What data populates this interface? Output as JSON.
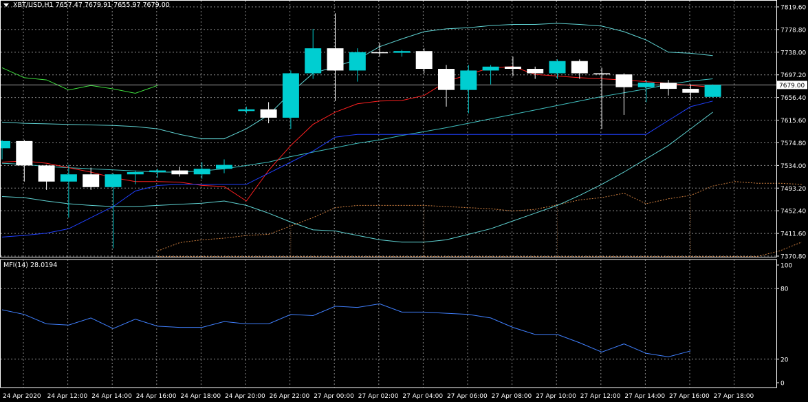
{
  "header": {
    "symbol_info": "XBT/USD,H1  7657.47 7679.91 7655.97 7679.00"
  },
  "mfi": {
    "label": "MFI(14) 28.0194"
  },
  "colors": {
    "background": "#000000",
    "grid": "#ffffff",
    "bull_candle": "#00ced1",
    "bear_candle": "#ffffff",
    "bb_outer": "#5fd3d3",
    "bb_mid": "#40c0c0",
    "red_line": "#ff2020",
    "blue_line": "#2040ff",
    "green_line": "#40e040",
    "ichimoku_cloud": "#d08040",
    "mfi_line": "#4080ff",
    "price_line": "#cccccc"
  },
  "chart_data": [
    {
      "type": "candlestick",
      "title": "XBT/USD,H1",
      "current_price": 7679.0,
      "current_price_label": "7679.00",
      "ylim": [
        7370.8,
        7819.6
      ],
      "y_ticks": [
        "7819.60",
        "7778.80",
        "7738.00",
        "7697.20",
        "7656.40",
        "7615.60",
        "7574.80",
        "7534.00",
        "7493.20",
        "7452.40",
        "7411.60",
        "7370.80"
      ],
      "y_tick_values": [
        7819.6,
        7778.8,
        7738.0,
        7697.2,
        7656.4,
        7615.6,
        7574.8,
        7534.0,
        7493.2,
        7452.4,
        7411.6,
        7370.8
      ],
      "x_labels": [
        "24 Apr 2020",
        "24 Apr 12:00",
        "24 Apr 14:00",
        "24 Apr 16:00",
        "24 Apr 18:00",
        "24 Apr 20:00",
        "26 Apr 22:00",
        "27 Apr 00:00",
        "27 Apr 02:00",
        "27 Apr 04:00",
        "27 Apr 06:00",
        "27 Apr 08:00",
        "27 Apr 10:00",
        "27 Apr 12:00",
        "27 Apr 14:00",
        "27 Apr 16:00",
        "27 Apr 18:00"
      ],
      "candles": [
        {
          "o": 7565,
          "h": 7580,
          "l": 7545,
          "c": 7578
        },
        {
          "o": 7578,
          "h": 7580,
          "l": 7505,
          "c": 7534
        },
        {
          "o": 7534,
          "h": 7535,
          "l": 7490,
          "c": 7505
        },
        {
          "o": 7505,
          "h": 7535,
          "l": 7440,
          "c": 7518
        },
        {
          "o": 7518,
          "h": 7530,
          "l": 7490,
          "c": 7495
        },
        {
          "o": 7495,
          "h": 7520,
          "l": 7385,
          "c": 7518
        },
        {
          "o": 7518,
          "h": 7525,
          "l": 7500,
          "c": 7522
        },
        {
          "o": 7522,
          "h": 7528,
          "l": 7512,
          "c": 7525
        },
        {
          "o": 7525,
          "h": 7532,
          "l": 7514,
          "c": 7518
        },
        {
          "o": 7518,
          "h": 7540,
          "l": 7510,
          "c": 7528
        },
        {
          "o": 7528,
          "h": 7545,
          "l": 7520,
          "c": 7535
        },
        {
          "o": 7632,
          "h": 7640,
          "l": 7628,
          "c": 7635
        },
        {
          "o": 7635,
          "h": 7648,
          "l": 7610,
          "c": 7620
        },
        {
          "o": 7620,
          "h": 7705,
          "l": 7600,
          "c": 7700
        },
        {
          "o": 7700,
          "h": 7780,
          "l": 7690,
          "c": 7745
        },
        {
          "o": 7745,
          "h": 7808,
          "l": 7650,
          "c": 7705
        },
        {
          "o": 7705,
          "h": 7745,
          "l": 7685,
          "c": 7738
        },
        {
          "o": 7738,
          "h": 7755,
          "l": 7730,
          "c": 7737
        },
        {
          "o": 7737,
          "h": 7742,
          "l": 7730,
          "c": 7740
        },
        {
          "o": 7740,
          "h": 7745,
          "l": 7700,
          "c": 7708
        },
        {
          "o": 7708,
          "h": 7715,
          "l": 7640,
          "c": 7670
        },
        {
          "o": 7670,
          "h": 7715,
          "l": 7628,
          "c": 7705
        },
        {
          "o": 7705,
          "h": 7715,
          "l": 7680,
          "c": 7712
        },
        {
          "o": 7712,
          "h": 7730,
          "l": 7695,
          "c": 7708
        },
        {
          "o": 7708,
          "h": 7712,
          "l": 7690,
          "c": 7700
        },
        {
          "o": 7700,
          "h": 7725,
          "l": 7690,
          "c": 7722
        },
        {
          "o": 7722,
          "h": 7725,
          "l": 7690,
          "c": 7700
        },
        {
          "o": 7700,
          "h": 7710,
          "l": 7600,
          "c": 7698
        },
        {
          "o": 7698,
          "h": 7700,
          "l": 7625,
          "c": 7675
        },
        {
          "o": 7675,
          "h": 7688,
          "l": 7648,
          "c": 7683
        },
        {
          "o": 7683,
          "h": 7688,
          "l": 7660,
          "c": 7672
        },
        {
          "o": 7672,
          "h": 7680,
          "l": 7652,
          "c": 7665
        },
        {
          "o": 7657.47,
          "h": 7679.91,
          "l": 7655.97,
          "c": 7679.0
        }
      ],
      "series": [
        {
          "name": "bb_upper",
          "values": [
            7612,
            7610,
            7609,
            7608,
            7607,
            7606,
            7604,
            7600,
            7590,
            7582,
            7582,
            7600,
            7625,
            7665,
            7700,
            7712,
            7725,
            7748,
            7762,
            7775,
            7780,
            7782,
            7786,
            7788,
            7788,
            7790,
            7788,
            7785,
            7775,
            7760,
            7738,
            7736,
            7732
          ]
        },
        {
          "name": "bb_middle",
          "values": [
            7538,
            7536,
            7532,
            7530,
            7528,
            7526,
            7524,
            7522,
            7522,
            7524,
            7528,
            7534,
            7540,
            7550,
            7558,
            7566,
            7574,
            7580,
            7588,
            7595,
            7602,
            7610,
            7618,
            7626,
            7634,
            7642,
            7650,
            7658,
            7665,
            7672,
            7680,
            7686,
            7690
          ]
        },
        {
          "name": "bb_lower",
          "values": [
            7478,
            7476,
            7470,
            7465,
            7462,
            7460,
            7460,
            7462,
            7464,
            7466,
            7470,
            7462,
            7448,
            7432,
            7418,
            7416,
            7408,
            7400,
            7396,
            7396,
            7400,
            7410,
            7420,
            7434,
            7448,
            7462,
            7480,
            7500,
            7522,
            7546,
            7570,
            7600,
            7630
          ]
        },
        {
          "name": "red_line",
          "values": [
            7540,
            7542,
            7538,
            7530,
            7522,
            7512,
            7505,
            7505,
            7504,
            7498,
            7496,
            7470,
            7525,
            7570,
            7608,
            7630,
            7645,
            7650,
            7651,
            7660,
            7685,
            7698,
            7710,
            7712,
            7698,
            7695,
            7692,
            7690,
            7688,
            7685,
            7682,
            7678,
            7675
          ]
        },
        {
          "name": "blue_line",
          "values": [
            7405,
            7408,
            7412,
            7420,
            7440,
            7460,
            7488,
            7498,
            7500,
            7500,
            7500,
            7500,
            7520,
            7540,
            7560,
            7585,
            7590,
            7590,
            7590,
            7590,
            7590,
            7590,
            7590,
            7590,
            7590,
            7590,
            7590,
            7590,
            7590,
            7590,
            7615,
            7640,
            7650
          ]
        },
        {
          "name": "green_line",
          "values": [
            7710,
            7692,
            7688,
            7670,
            7678,
            7672,
            7664,
            7678
          ]
        },
        {
          "name": "cloud_upper",
          "values": [
            null,
            null,
            null,
            null,
            null,
            null,
            null,
            7380,
            7395,
            7400,
            7403,
            7408,
            7410,
            7425,
            7440,
            7458,
            7462,
            7462,
            7462,
            7462,
            7460,
            7458,
            7456,
            7452,
            7455,
            7463,
            7472,
            7476,
            7484,
            7465,
            7474,
            7480,
            7497,
            7505,
            7502,
            7502,
            7500
          ]
        },
        {
          "name": "cloud_lower",
          "values": [
            null,
            null,
            null,
            null,
            null,
            null,
            null,
            7370,
            7370,
            7370,
            7370,
            7370,
            7370,
            7370,
            7370,
            7370,
            7370,
            7370,
            7370,
            7370,
            7370,
            7370,
            7370,
            7370,
            7370,
            7370,
            7370,
            7370,
            7370,
            7370,
            7370,
            7370,
            7370,
            7370,
            7370,
            7380,
            7396
          ]
        }
      ]
    },
    {
      "type": "line",
      "title": "MFI(14) 28.0194",
      "ylim": [
        0,
        100
      ],
      "y_ticks": [
        "100",
        "80",
        "20",
        "0"
      ],
      "y_tick_values": [
        100,
        80,
        20,
        0
      ],
      "series": [
        {
          "name": "MFI(14)",
          "values": [
            62,
            58,
            50,
            49,
            55,
            46,
            54,
            48,
            47,
            47,
            52,
            50,
            50,
            58,
            57,
            65,
            64,
            67,
            60,
            60,
            59,
            58,
            55,
            47,
            41,
            41,
            34,
            26,
            33,
            25,
            22,
            27
          ]
        }
      ]
    }
  ]
}
